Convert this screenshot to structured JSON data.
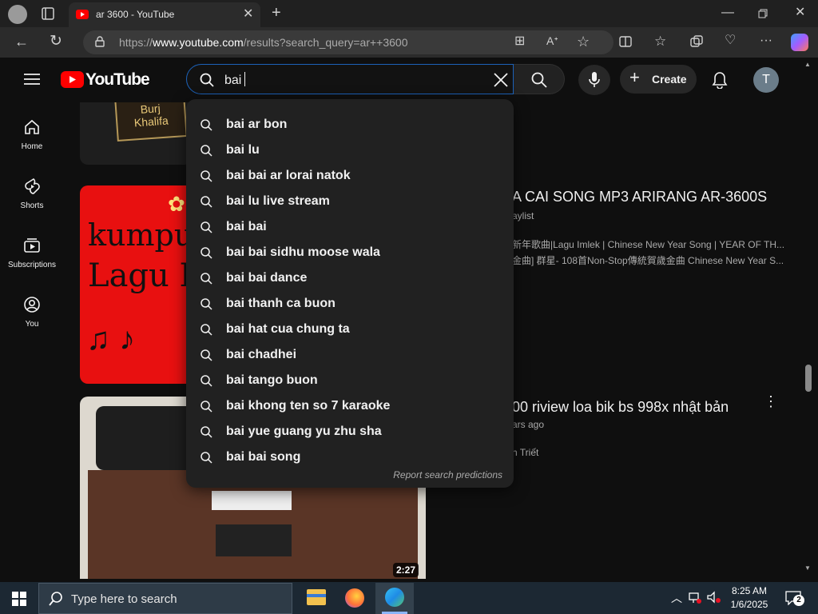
{
  "browser": {
    "tab_title": "ar 3600 - YouTube",
    "url_prefix": "https://",
    "url_domain": "www.youtube.com",
    "url_path": "/results?search_query=ar++3600"
  },
  "youtube": {
    "logo_text": "YouTube",
    "search_value": "bai",
    "create_label": "Create",
    "avatar_initial": "T",
    "sidebar": [
      {
        "label": "Home",
        "icon": "home-icon"
      },
      {
        "label": "Shorts",
        "icon": "shorts-icon"
      },
      {
        "label": "Subscriptions",
        "icon": "subscriptions-icon"
      },
      {
        "label": "You",
        "icon": "you-icon"
      }
    ],
    "suggestions": [
      "bai ar bon",
      "bai lu",
      "bai bai ar lorai natok",
      "bai lu live stream",
      "bai bai",
      "bai bai sidhu moose wala",
      "bai bai dance",
      "bai thanh ca buon",
      "bai hat cua chung ta",
      "bai chadhei",
      "bai tango buon",
      "bai khong ten so 7 karaoke",
      "bai yue guang yu zhu sha",
      "bai bai song"
    ],
    "report_label": "Report search predictions",
    "thumb1_text": [
      "Burj",
      "Khalifa"
    ],
    "thumb2_text": [
      "kumpula",
      "Lagu In"
    ],
    "result2": {
      "title": "A CAI SONG MP3 ARIRANG AR-3600S",
      "meta": "aylist",
      "line1": "新年歌曲|Lagu Imlek | Chinese New Year Song | YEAR OF TH...",
      "line2": "金曲] 群星- 108首Non-Stop傳統賀歲金曲 Chinese New Year S..."
    },
    "result3": {
      "title": "00 riview loa bik bs 998x nhật bản",
      "meta": "ars ago",
      "channel": "h Triết",
      "duration": "2:27"
    }
  },
  "taskbar": {
    "search_placeholder": "Type here to search",
    "time": "8:25 AM",
    "date": "1/6/2025",
    "notification_count": "2"
  },
  "colors": {
    "yt_red": "#ff0000",
    "search_focus": "#1c62b9",
    "taskbar": "#1c2833"
  }
}
